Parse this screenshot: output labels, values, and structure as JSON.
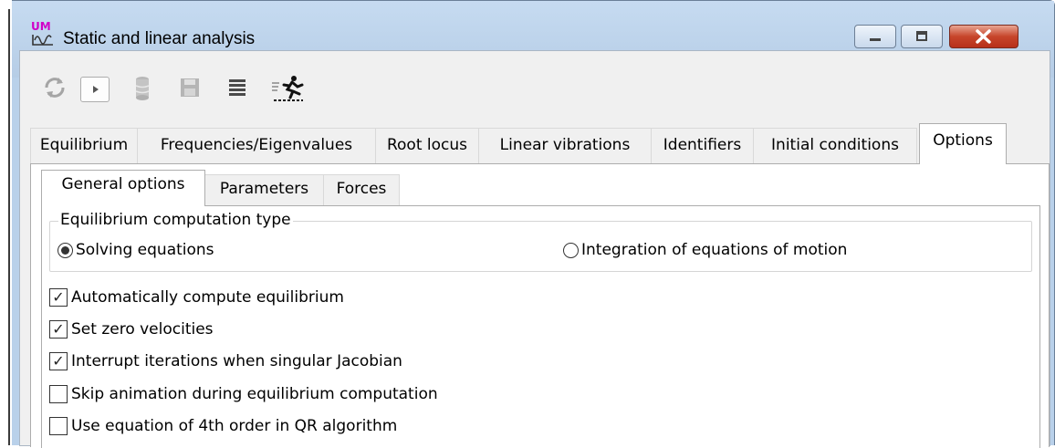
{
  "window": {
    "title": "Static and linear analysis",
    "icon": "um-analysis-icon",
    "controls": [
      "minimize-icon",
      "maximize-icon",
      "close-icon"
    ]
  },
  "toolbar": {
    "buttons": [
      {
        "icon": "refresh-icon",
        "enabled": false
      },
      {
        "icon": "play-icon",
        "enabled": true
      },
      {
        "icon": "database-icon",
        "enabled": false
      },
      {
        "icon": "save-icon",
        "enabled": false
      },
      {
        "icon": "list-icon",
        "enabled": false
      },
      {
        "icon": "running-man-icon",
        "enabled": true
      }
    ]
  },
  "tabs": [
    {
      "label": "Equilibrium"
    },
    {
      "label": "Frequencies/Eigenvalues"
    },
    {
      "label": "Root locus"
    },
    {
      "label": "Linear vibrations"
    },
    {
      "label": "Identifiers"
    },
    {
      "label": "Initial conditions"
    },
    {
      "label": "Options",
      "active": true
    }
  ],
  "subtabs": [
    {
      "label": "General options",
      "active": true
    },
    {
      "label": "Parameters"
    },
    {
      "label": "Forces"
    }
  ],
  "equilibrium_group": {
    "title": "Equilibrium computation type",
    "options": [
      {
        "label": "Solving equations",
        "selected": true
      },
      {
        "label": "Integration of equations of motion",
        "selected": false
      }
    ]
  },
  "checkboxes": [
    {
      "label": "Automatically compute equilibrium",
      "checked": true,
      "mark": "✓"
    },
    {
      "label": "Set zero velocities",
      "checked": true,
      "mark": "✓"
    },
    {
      "label": "Interrupt iterations when singular Jacobian",
      "checked": true,
      "mark": "✓"
    },
    {
      "label": "Skip animation during equilibrium computation",
      "checked": false,
      "mark": ""
    },
    {
      "label": "Use equation of 4th order in QR algorithm",
      "checked": false,
      "mark": ""
    }
  ],
  "colors": {
    "titlebar": "#b9d1ea",
    "close": "#c7452b",
    "accent_um": "#d000c8"
  }
}
